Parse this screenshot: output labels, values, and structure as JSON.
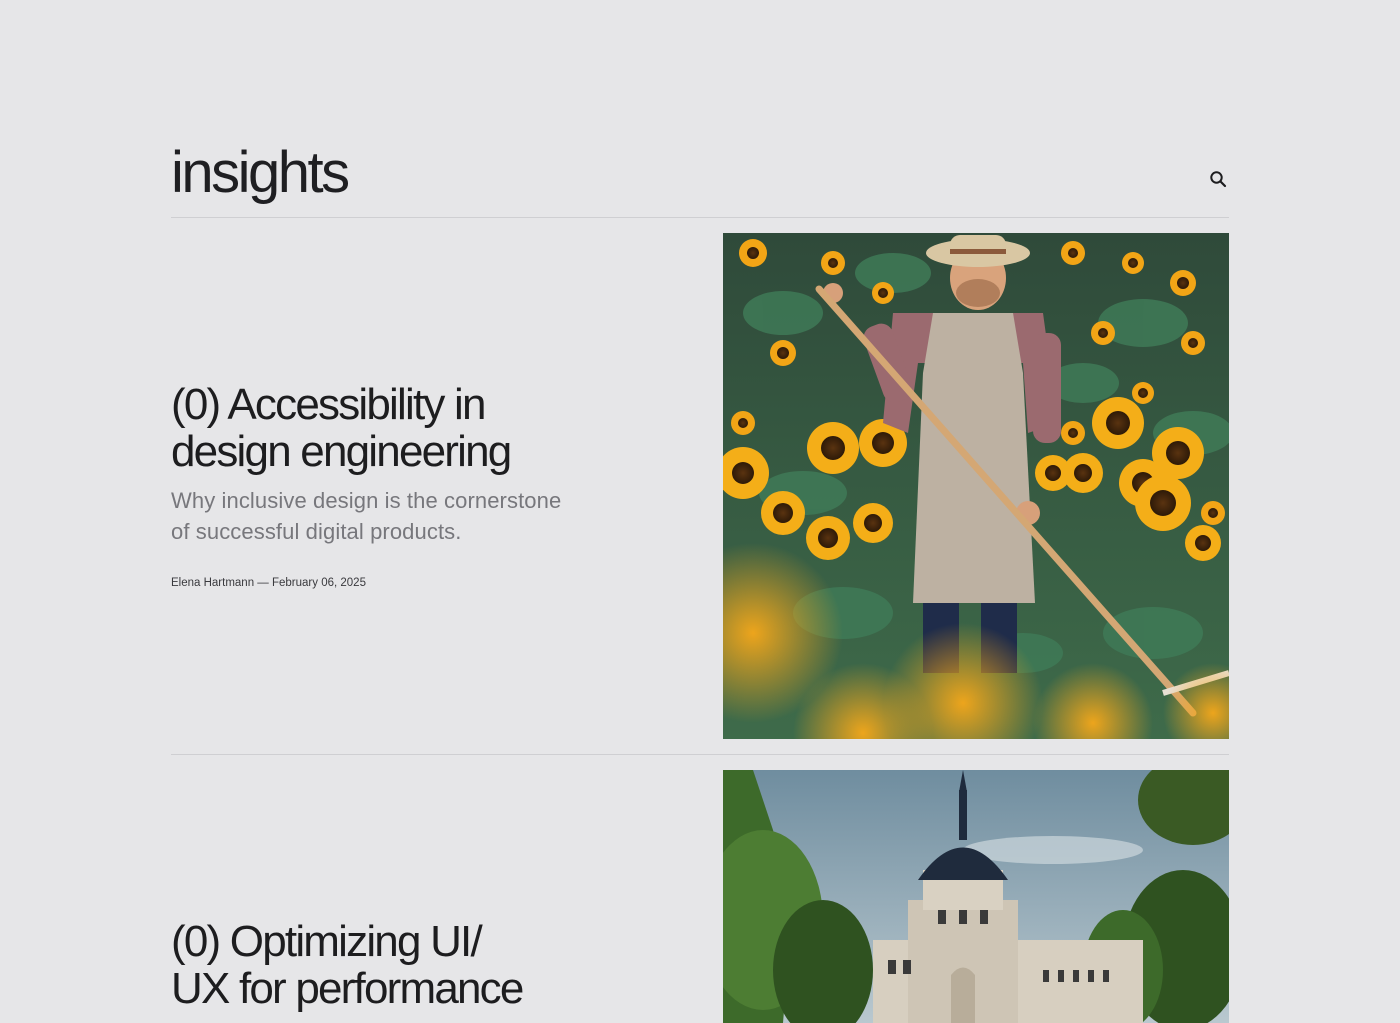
{
  "header": {
    "title": "insights",
    "search_icon": "search-icon"
  },
  "articles": [
    {
      "count": "(0)",
      "title": "(0) Accessibility in design engineering",
      "title_line1": "(0) Accessibility in",
      "title_line2": "design engineering",
      "subtitle_line1": "Why inclusive design is the cornerstone",
      "subtitle_line2": "of successful digital products.",
      "meta": "Elena Hartmann — February 06, 2025",
      "image": "farmer-in-sunflower-field"
    },
    {
      "count": "(0)",
      "title": "(0) Optimizing UI/ UX for performance",
      "title_line1": "(0) Optimizing UI/",
      "title_line2": "UX for performance",
      "image": "domed-palace-among-trees"
    }
  ]
}
